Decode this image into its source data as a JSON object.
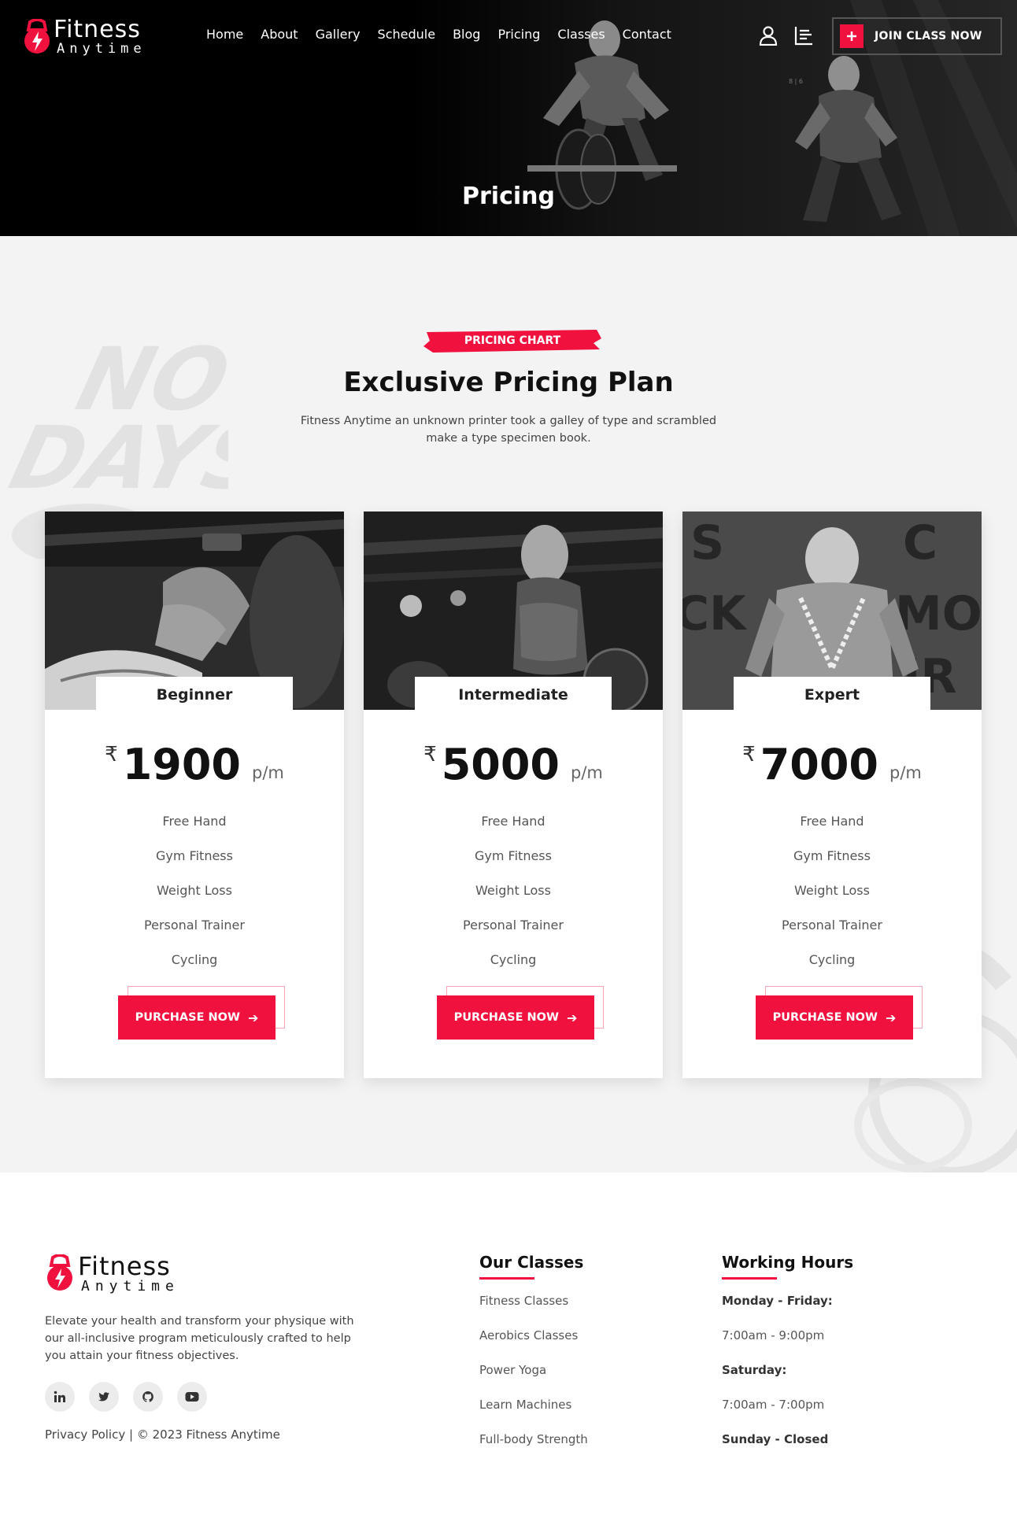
{
  "brand": {
    "name_line1": "Fitness",
    "name_line2": "Anytime"
  },
  "nav": {
    "items": [
      "Home",
      "About",
      "Gallery",
      "Schedule",
      "Blog",
      "Pricing",
      "Classes",
      "Contact"
    ],
    "icons": {
      "account": "user-icon",
      "menu": "list-menu-icon",
      "join": "plus-icon"
    },
    "cta_label": "JOIN CLASS NOW"
  },
  "hero": {
    "title": "Pricing"
  },
  "pricing": {
    "badge": "PRICING CHART",
    "title": "Exclusive Pricing Plan",
    "description": "Fitness Anytime an unknown printer took a galley of type and scrambled make a type specimen book.",
    "plans": [
      {
        "name": "Beginner",
        "currency": "₹",
        "price": "1900",
        "period": "p/m",
        "features": [
          "Free Hand",
          "Gym Fitness",
          "Weight Loss",
          "Personal Trainer",
          "Cycling"
        ],
        "button": "PURCHASE NOW"
      },
      {
        "name": "Intermediate",
        "currency": "₹",
        "price": "5000",
        "period": "p/m",
        "features": [
          "Free Hand",
          "Gym Fitness",
          "Weight Loss",
          "Personal Trainer",
          "Cycling"
        ],
        "button": "PURCHASE NOW"
      },
      {
        "name": "Expert",
        "currency": "₹",
        "price": "7000",
        "period": "p/m",
        "features": [
          "Free Hand",
          "Gym Fitness",
          "Weight Loss",
          "Personal Trainer",
          "Cycling"
        ],
        "button": "PURCHASE NOW"
      }
    ]
  },
  "footer": {
    "description": "Elevate your health and transform your physique with our all-inclusive program meticulously crafted to help you attain your fitness objectives.",
    "socials": [
      "linkedin-icon",
      "twitter-icon",
      "github-icon",
      "youtube-icon"
    ],
    "privacy": "Privacy Policy",
    "copyright": "| © 2023 Fitness Anytime",
    "classes": {
      "title": "Our Classes",
      "items": [
        "Fitness Classes",
        "Aerobics Classes",
        "Power Yoga",
        "Learn Machines",
        "Full-body Strength"
      ]
    },
    "hours": {
      "title": "Working Hours",
      "items": [
        "Monday - Friday:",
        "7:00am - 9:00pm",
        "Saturday:",
        "7:00am - 7:00pm",
        "Sunday - Closed"
      ]
    }
  },
  "colors": {
    "accent": "#f0113f",
    "hero_bg": "#000000",
    "section_bg": "#f3f3f3"
  }
}
